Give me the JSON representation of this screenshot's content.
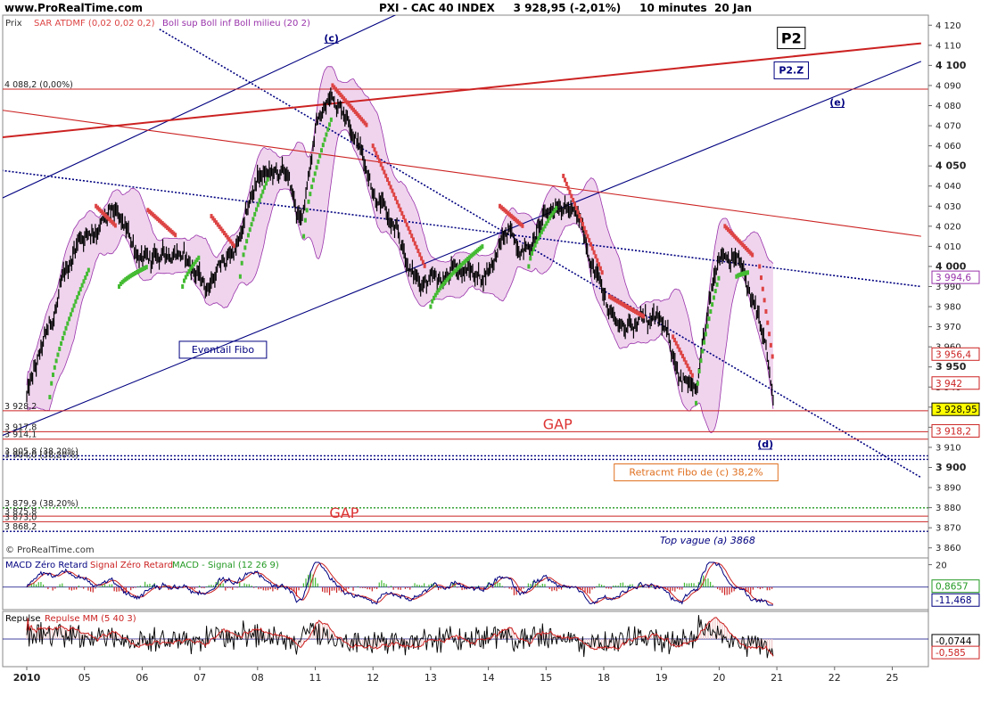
{
  "header": {
    "site": "www.ProRealTime.com",
    "title": "PXI - CAC 40 INDEX     3 928,95 (-2,01%)     10 minutes  20 Jan"
  },
  "footer": {
    "copyright": "© ProRealTime.com"
  },
  "colors": {
    "bullish_sar": "#44bb33",
    "bearish_sar": "#dd4444",
    "boll_fill": "#f0d4ee",
    "boll_line": "#9933aa",
    "blue_line": "#000080",
    "red_line": "#cc2222"
  },
  "chart_data": [
    {
      "type": "line",
      "name": "price",
      "legend": {
        "main": "Prix",
        "sar": "SAR ATDMF (0,02 0,02 0,2)",
        "boll": "Boll sup Boll inf Boll milieu (20 2)"
      },
      "x_ticks": [
        "2010",
        "05",
        "06",
        "07",
        "08",
        "11",
        "12",
        "13",
        "14",
        "15",
        "18",
        "19",
        "20",
        "21",
        "22",
        "25"
      ],
      "ylim": [
        3855,
        4125
      ],
      "y_ticks": [
        3860,
        3870,
        3880,
        3890,
        3900,
        3910,
        3920,
        3930,
        3940,
        3950,
        3960,
        3970,
        3980,
        3990,
        4000,
        4010,
        4020,
        4030,
        4040,
        4050,
        4060,
        4070,
        4080,
        4090,
        4100,
        4110,
        4120
      ],
      "y_tick_labels": [
        "3 860",
        "3 870",
        "3 880",
        "3 890",
        "3 900",
        "3 910",
        "3 920",
        "3 930",
        "3 940",
        "3 950",
        "3 960",
        "3 970",
        "3 980",
        "3 990",
        "4 000",
        "4 010",
        "4 020",
        "4 030",
        "4 040",
        "4 050",
        "4 060",
        "4 070",
        "4 080",
        "4 090",
        "4 100",
        "4 110",
        "4 120"
      ],
      "y_bold_ticks": [
        3900,
        3950,
        4000,
        4050,
        4100
      ],
      "price_waypoints": [
        [
          0,
          3935
        ],
        [
          0.35,
          3965
        ],
        [
          0.9,
          4015
        ],
        [
          1.5,
          4025
        ],
        [
          2.1,
          4000
        ],
        [
          2.6,
          4010
        ],
        [
          3.1,
          3990
        ],
        [
          3.7,
          4012
        ],
        [
          4.0,
          4045
        ],
        [
          4.5,
          4045
        ],
        [
          4.75,
          4020
        ],
        [
          5.0,
          4070
        ],
        [
          5.3,
          4085
        ],
        [
          5.6,
          4075
        ],
        [
          6.0,
          4040
        ],
        [
          6.4,
          4015
        ],
        [
          6.7,
          3995
        ],
        [
          7.1,
          3990
        ],
        [
          7.5,
          4000
        ],
        [
          7.9,
          3995
        ],
        [
          8.3,
          4015
        ],
        [
          8.7,
          4010
        ],
        [
          9.0,
          4025
        ],
        [
          9.25,
          4035
        ],
        [
          9.6,
          4020
        ],
        [
          10.0,
          3985
        ],
        [
          10.3,
          3970
        ],
        [
          10.6,
          3975
        ],
        [
          11.0,
          3970
        ],
        [
          11.3,
          3950
        ],
        [
          11.6,
          3935
        ],
        [
          12.0,
          4010
        ],
        [
          12.3,
          4005
        ],
        [
          12.55,
          3985
        ],
        [
          12.8,
          3960
        ],
        [
          12.95,
          3928
        ]
      ],
      "sar_segments": [
        {
          "trend": "bull",
          "from": 0.4,
          "to": 1.1,
          "v0": 3935,
          "v1": 4000
        },
        {
          "trend": "bear",
          "from": 1.2,
          "to": 1.55,
          "v0": 4030,
          "v1": 4020
        },
        {
          "trend": "bull",
          "from": 1.6,
          "to": 2.1,
          "v0": 3990,
          "v1": 4000
        },
        {
          "trend": "bear",
          "from": 2.1,
          "to": 2.6,
          "v0": 4028,
          "v1": 4015
        },
        {
          "trend": "bull",
          "from": 2.7,
          "to": 3.0,
          "v0": 3990,
          "v1": 4005
        },
        {
          "trend": "bear",
          "from": 3.2,
          "to": 3.6,
          "v0": 4025,
          "v1": 4010
        },
        {
          "trend": "bull",
          "from": 3.7,
          "to": 4.2,
          "v0": 3995,
          "v1": 4045
        },
        {
          "trend": "bull",
          "from": 4.8,
          "to": 5.3,
          "v0": 4015,
          "v1": 4075
        },
        {
          "trend": "bear",
          "from": 5.3,
          "to": 5.9,
          "v0": 4090,
          "v1": 4070
        },
        {
          "trend": "bear",
          "from": 6.0,
          "to": 6.9,
          "v0": 4060,
          "v1": 4000
        },
        {
          "trend": "bull",
          "from": 7.0,
          "to": 7.9,
          "v0": 3980,
          "v1": 4010
        },
        {
          "trend": "bear",
          "from": 8.2,
          "to": 8.6,
          "v0": 4030,
          "v1": 4020
        },
        {
          "trend": "bull",
          "from": 8.7,
          "to": 9.2,
          "v0": 4000,
          "v1": 4030
        },
        {
          "trend": "bear",
          "from": 9.3,
          "to": 10.0,
          "v0": 4045,
          "v1": 3995
        },
        {
          "trend": "bear",
          "from": 10.1,
          "to": 10.7,
          "v0": 3985,
          "v1": 3975
        },
        {
          "trend": "bear",
          "from": 11.2,
          "to": 11.55,
          "v0": 3965,
          "v1": 3945
        },
        {
          "trend": "bull",
          "from": 11.6,
          "to": 12.0,
          "v0": 3932,
          "v1": 3995
        },
        {
          "trend": "bear",
          "from": 12.1,
          "to": 12.6,
          "v0": 4020,
          "v1": 4005
        },
        {
          "trend": "bull",
          "from": 12.3,
          "to": 12.5,
          "v0": 3995,
          "v1": 3997
        },
        {
          "trend": "bear",
          "from": 12.7,
          "to": 12.95,
          "v0": 4000,
          "v1": 3950
        }
      ],
      "hlines": [
        {
          "value": 4088.2,
          "label": "4 088,2 (0,00%)",
          "color": "#cc2222",
          "style": "solid"
        },
        {
          "value": 3928.2,
          "label": "3 928,2",
          "color": "#cc2222",
          "style": "solid"
        },
        {
          "value": 3917.8,
          "label": "3 917,8",
          "color": "#cc2222",
          "style": "solid"
        },
        {
          "value": 3914.1,
          "label": "3 914,1",
          "color": "#cc2222",
          "style": "solid"
        },
        {
          "value": 3905.8,
          "label": "3 905,8 (38,20%)",
          "color": "#000080",
          "style": "dotted"
        },
        {
          "value": 3904.0,
          "label": "3 904,0 (38,20%)",
          "color": "#000080",
          "style": "dotted"
        },
        {
          "value": 3879.9,
          "label": "3 879,9 (38,20%)",
          "color": "#229922",
          "style": "dotted"
        },
        {
          "value": 3875.8,
          "label": "3 875,8",
          "color": "#cc2222",
          "style": "solid"
        },
        {
          "value": 3873.0,
          "label": "3 873,0",
          "color": "#cc2222",
          "style": "solid"
        },
        {
          "value": 3868.2,
          "label": "3 868,2",
          "color": "#000080",
          "style": "dotted"
        }
      ],
      "trend_lines": [
        {
          "style": "dotted",
          "color": "#000080",
          "p1": [
            2.3,
            4118
          ],
          "p2": [
            15.5,
            3895
          ]
        },
        {
          "style": "dotted",
          "color": "#000080",
          "p1": [
            -0.5,
            4048
          ],
          "p2": [
            15.5,
            3990
          ]
        },
        {
          "style": "solid",
          "color": "#000080",
          "p1": [
            -0.5,
            3915
          ],
          "p2": [
            15.5,
            4102
          ]
        },
        {
          "style": "solid",
          "color": "#000080",
          "p1": [
            -0.5,
            4033
          ],
          "p2": [
            10.5,
            4180
          ]
        },
        {
          "style": "solid",
          "color": "#cc2222",
          "p1": [
            -0.5,
            4064
          ],
          "p2": [
            15.5,
            4111
          ]
        },
        {
          "style": "solid",
          "color": "#cc2222",
          "p1": [
            -0.5,
            4078
          ],
          "p2": [
            15.5,
            4015
          ]
        }
      ],
      "right_badges": [
        {
          "value": 3994.6,
          "label": "3 994,6",
          "fill": "#ffffff",
          "stroke": "#9933aa",
          "text": "#9933aa"
        },
        {
          "value": 3956.4,
          "label": "3 956,4",
          "fill": "#ffffff",
          "stroke": "#cc2222",
          "text": "#cc2222"
        },
        {
          "value": 3942,
          "label": "3 942",
          "fill": "#ffffff",
          "stroke": "#cc2222",
          "text": "#cc2222"
        },
        {
          "value": 3928.95,
          "label": "3 928,95",
          "fill": "#ffff00",
          "stroke": "#000000",
          "text": "#000000"
        },
        {
          "value": 3918.2,
          "label": "3 918,2",
          "fill": "#ffffff",
          "stroke": "#cc2222",
          "text": "#cc2222"
        }
      ],
      "annotations": [
        {
          "text": "(c)",
          "x": 5.28,
          "y": 4112,
          "color": "#000080",
          "box": false,
          "bold": true
        },
        {
          "text": "P2",
          "x": 13.25,
          "y": 4111,
          "color": "#000000",
          "box": true,
          "big": true
        },
        {
          "text": "P2.Z",
          "x": 13.25,
          "y": 4096,
          "color": "#000080",
          "box": true,
          "bold": true
        },
        {
          "text": "(e)",
          "x": 14.05,
          "y": 4080,
          "color": "#000080",
          "box": false,
          "bold": true
        },
        {
          "text": "Eventail Fibo",
          "x": 3.4,
          "y": 3957,
          "color": "#000080",
          "box": true
        },
        {
          "text": "GAP",
          "x": 9.2,
          "y": 3919,
          "color": "#dd3333",
          "box": false,
          "big": true
        },
        {
          "text": "(d)",
          "x": 12.8,
          "y": 3910,
          "color": "#000080",
          "box": false,
          "bold": true
        },
        {
          "text": "Retracmt Fibo de (c) 38,2%",
          "x": 11.6,
          "y": 3896,
          "color": "#e07020",
          "box": true
        },
        {
          "text": "GAP",
          "x": 5.5,
          "y": 3875,
          "color": "#dd3333",
          "box": false,
          "big": true
        },
        {
          "text": "Top vague (a) 3868",
          "x": 11.8,
          "y": 3862,
          "color": "#000080",
          "box": false,
          "italic": true
        }
      ]
    },
    {
      "type": "line",
      "name": "macd",
      "legend": {
        "a": "MACD Zéro Retard",
        "b": "Signal Zéro Retard",
        "c": "MACD - Signal (12 26 9)"
      },
      "ylim": [
        -20,
        26
      ],
      "y_ticks": [
        20
      ],
      "y_tick_labels": [
        "20"
      ],
      "right_badges": [
        {
          "value": 0.8657,
          "label": "0,8657",
          "fill": "#ffffff",
          "stroke": "#229922",
          "text": "#229922"
        },
        {
          "value": -11.468,
          "label": "-11,468",
          "fill": "#ffffff",
          "stroke": "#000080",
          "text": "#000080"
        }
      ]
    },
    {
      "type": "line",
      "name": "repulse",
      "legend": {
        "a": "Repulse",
        "b": "Repulse MM (5 40 3)"
      },
      "ylim": [
        -1.2,
        1.2
      ],
      "right_badges": [
        {
          "value": -0.0744,
          "label": "-0,0744",
          "fill": "#ffffff",
          "stroke": "#000000",
          "text": "#000000"
        },
        {
          "value": -0.585,
          "label": "-0,585",
          "fill": "#ffffff",
          "stroke": "#cc2222",
          "text": "#cc2222"
        }
      ]
    }
  ]
}
